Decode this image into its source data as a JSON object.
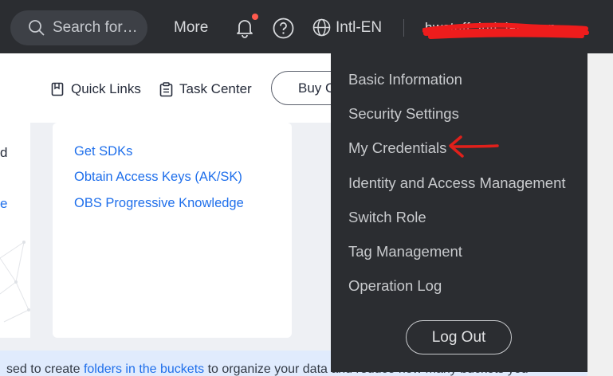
{
  "topbar": {
    "search_placeholder": "Search for…",
    "more_label": "More",
    "language_label": "Intl-EN",
    "username": "hwstaff_intl_lan_app"
  },
  "subbar": {
    "quick_links_label": "Quick Links",
    "task_center_label": "Task Center",
    "buy_label": "Buy C"
  },
  "left_card": {
    "fragment_1": "d",
    "fragment_2": "e"
  },
  "resources_card": {
    "links": [
      "Get SDKs",
      "Obtain Access Keys (AK/SK)",
      "OBS Progressive Knowledge"
    ]
  },
  "banner": {
    "text_before": "sed to create ",
    "link_text": "folders in the buckets",
    "text_after": " to organize your data and reduce how many buckets you"
  },
  "account_menu": {
    "items": [
      "Basic Information",
      "Security Settings",
      "My Credentials",
      "Identity and Access Management",
      "Switch Role",
      "Tag Management",
      "Operation Log"
    ],
    "logout_label": "Log Out"
  },
  "annotation": {
    "arrow_color": "#e0201b",
    "redaction_color": "#ee1c1c"
  },
  "colors": {
    "topbar_bg": "#2b2d31",
    "link_blue": "#1f6feb",
    "notification_dot": "#ff5a4e"
  }
}
